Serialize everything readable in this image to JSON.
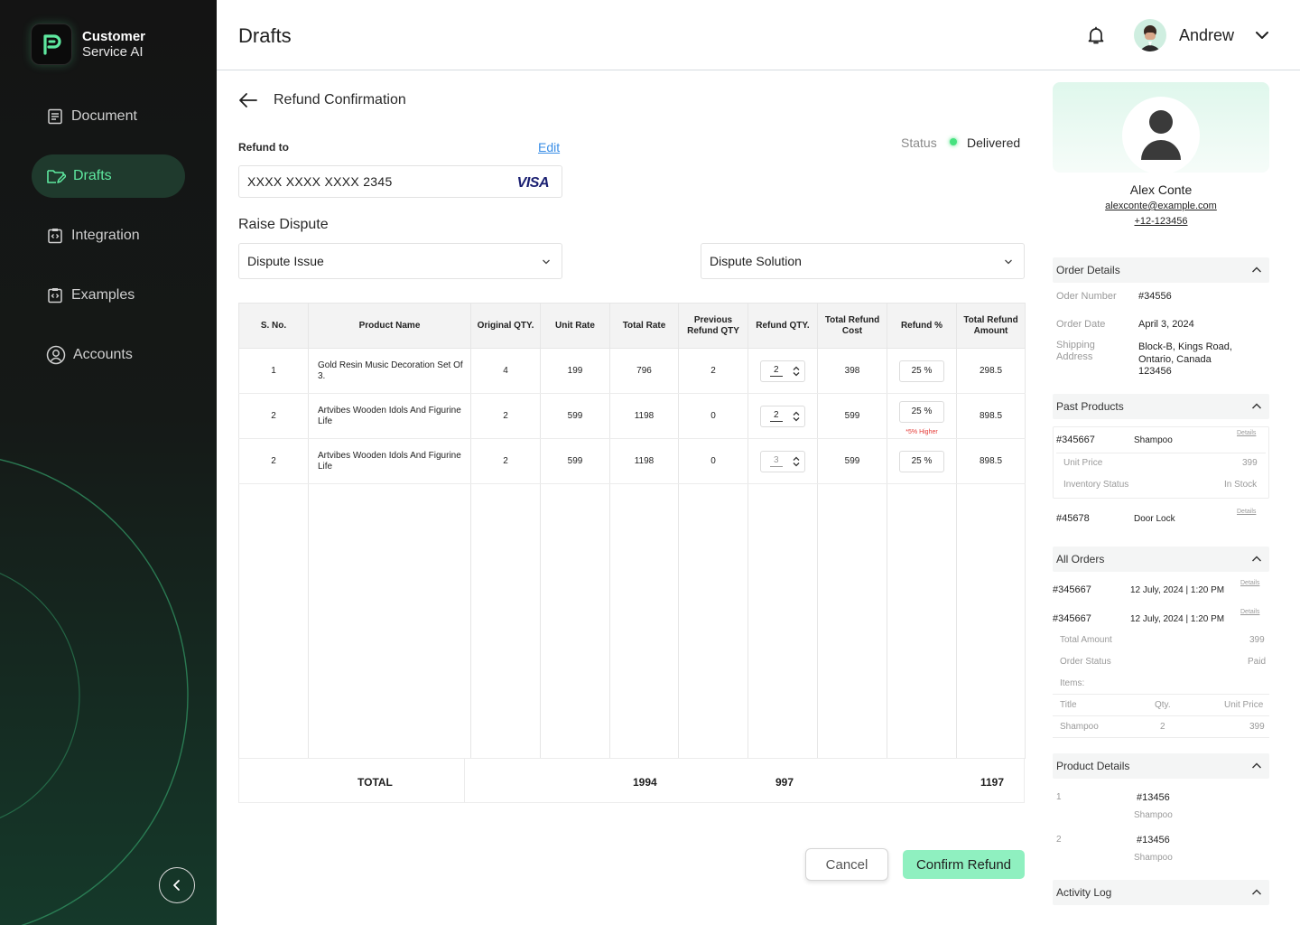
{
  "brand": {
    "line1": "Customer",
    "line2": "Service AI",
    "accent": "#5EE89F"
  },
  "sidebar": {
    "items": [
      {
        "label": "Document",
        "icon": "document-icon",
        "active": false
      },
      {
        "label": "Drafts",
        "icon": "drafts-folder-icon",
        "active": true
      },
      {
        "label": "Integration",
        "icon": "integration-icon",
        "active": false
      },
      {
        "label": "Examples",
        "icon": "examples-icon",
        "active": false
      },
      {
        "label": "Accounts",
        "icon": "account-icon",
        "active": false
      }
    ]
  },
  "header": {
    "title": "Drafts",
    "user_name": "Andrew"
  },
  "main": {
    "section_title": "Refund Confirmation",
    "refund_to_label": "Refund to",
    "edit_label": "Edit",
    "status_label": "Status",
    "status_value": "Delivered",
    "status_color": "#46E27F",
    "card_number": "XXXX XXXX XXXX 2345",
    "card_brand": "VISA",
    "raise_dispute": "Raise Dispute",
    "dispute_issue": "Dispute Issue",
    "dispute_solution": "Dispute Solution"
  },
  "table": {
    "headers": [
      "S. No.",
      "Product Name",
      "Original QTY.",
      "Unit Rate",
      "Total Rate",
      "Previous Refund QTY",
      "Refund QTY.",
      "Total Refund Cost",
      "Refund %",
      "Total Refund Amount"
    ],
    "rows": [
      {
        "sno": "1",
        "name": "Gold Resin Music Decoration Set Of 3.",
        "orig_qty": "4",
        "unit_rate": "199",
        "total_rate": "796",
        "prev_refund": "2",
        "refund_qty": "2",
        "refund_cost": "398",
        "refund_pct": "25 %",
        "note": "",
        "refund_amount": "298.5"
      },
      {
        "sno": "2",
        "name": "Artvibes Wooden Idols And Figurine Life",
        "orig_qty": "2",
        "unit_rate": "599",
        "total_rate": "1198",
        "prev_refund": "0",
        "refund_qty": "2",
        "refund_cost": "599",
        "refund_pct": "25 %",
        "note": "*5% Higher",
        "refund_amount": "898.5"
      },
      {
        "sno": "2",
        "name": "Artvibes Wooden Idols And Figurine Life",
        "orig_qty": "2",
        "unit_rate": "599",
        "total_rate": "1198",
        "prev_refund": "0",
        "refund_qty": "3",
        "refund_cost": "599",
        "refund_pct": "25 %",
        "note": "",
        "refund_amount": "898.5"
      }
    ],
    "total_label": "TOTAL",
    "total_rate": "1994",
    "total_refund_cost": "997",
    "total_refund_amount": "1197"
  },
  "actions": {
    "cancel": "Cancel",
    "confirm": "Confirm Refund",
    "confirm_color": "#8FF0C0"
  },
  "customer": {
    "name": "Alex Conte",
    "email": "alexconte@example.com",
    "phone": "+12-123456"
  },
  "order_details": {
    "title": "Order Details",
    "number_label": "Oder Number",
    "number": "#34556",
    "date_label": "Order Date",
    "date": "April 3, 2024",
    "address_label_1": "Shipping",
    "address_label_2": "Address",
    "address_1": "Block-B, Kings Road,",
    "address_2": "Ontario, Canada",
    "address_3": "123456"
  },
  "past_products": {
    "title": "Past Products",
    "items": [
      {
        "id": "#345667",
        "name": "Shampoo",
        "details": "Details",
        "unit_price_label": "Unit Price",
        "unit_price": "399",
        "inventory_label": "Inventory Status",
        "inventory": "In Stock"
      },
      {
        "id": "#45678",
        "name": "Door Lock",
        "details": "Details"
      }
    ]
  },
  "all_orders": {
    "title": "All Orders",
    "orders": [
      {
        "id": "#345667",
        "datetime": "12 July, 2024 | 1:20 PM",
        "details": "Details"
      },
      {
        "id": "#345667",
        "datetime": "12 July, 2024 | 1:20 PM",
        "details": "Details"
      }
    ],
    "total_amount_label": "Total Amount",
    "total_amount": "399",
    "order_status_label": "Order Status",
    "order_status": "Paid",
    "items_label": "Items:",
    "col_title": "Title",
    "col_qty": "Qty.",
    "col_price": "Unit Price",
    "item_title": "Shampoo",
    "item_qty": "2",
    "item_price": "399"
  },
  "product_details": {
    "title": "Product Details",
    "items": [
      {
        "index": "1",
        "id": "#13456",
        "name": "Shampoo"
      },
      {
        "index": "2",
        "id": "#13456",
        "name": "Shampoo"
      }
    ]
  },
  "activity_log": {
    "title": "Activity Log"
  }
}
